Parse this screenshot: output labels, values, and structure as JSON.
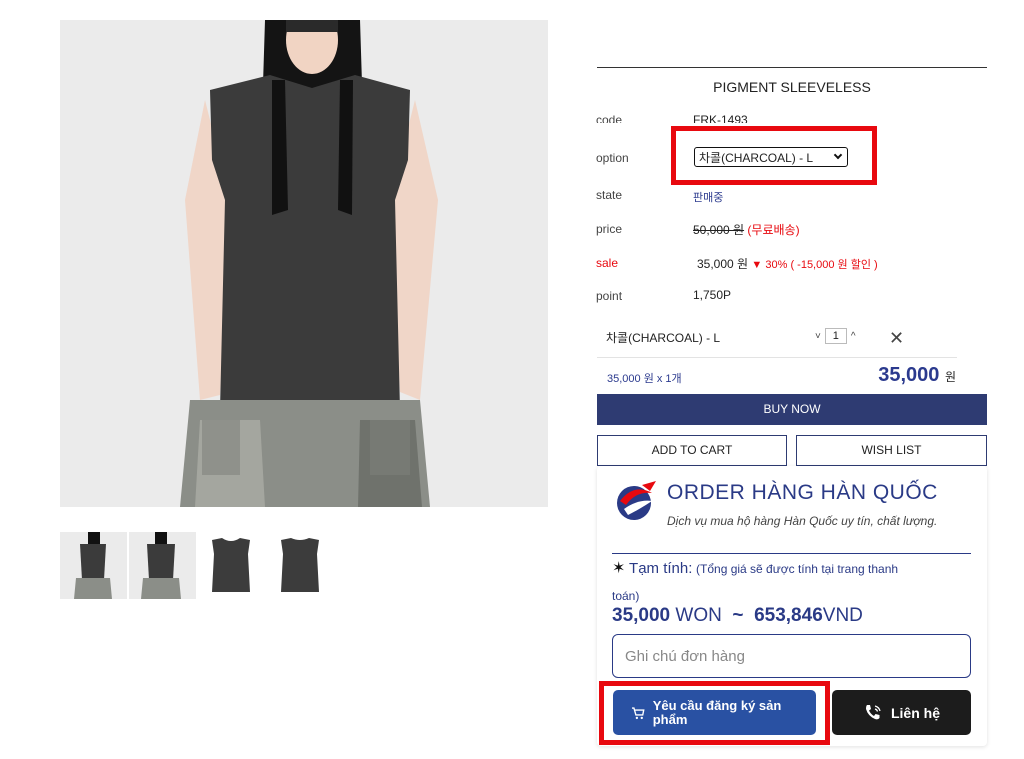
{
  "product": {
    "title": "PIGMENT SLEEVELESS",
    "rows": {
      "code_label": "code",
      "code_value": "FRK-1493",
      "option_label": "option",
      "option_value": "차콜(CHARCOAL) - L",
      "state_label": "state",
      "state_value": "판매중",
      "price_label": "price",
      "price_value": "50,000 원",
      "price_note": "(무료배송)",
      "sale_label": "sale",
      "sale_value": "35,000 원",
      "sale_discount": "▼ 30% ( -15,000 원 할인 )",
      "point_label": "point",
      "point_value": "1,750P"
    },
    "selected": {
      "name": "차콜(CHARCOAL) - L",
      "qty": "1",
      "up": "^",
      "down": "˅",
      "remove": "✕"
    },
    "summary": {
      "left": "35,000 원 x 1개",
      "total": "35,000",
      "unit": "원"
    },
    "buttons": {
      "buy_now": "BUY NOW",
      "add_to_cart": "ADD TO CART",
      "wish_list": "WISH LIST"
    }
  },
  "widget": {
    "title": "ORDER HÀNG HÀN QUỐC",
    "subtitle": "Dịch vụ mua hộ hàng Hàn Quốc uy tín, chất lượng.",
    "tam_tinh": "Tạm tính:",
    "tam_tinh_note": "(Tổng giá sẽ được tính tại trang thanh",
    "tam_tinh_note2": "toán)",
    "price_won": "35,000",
    "won_label": "WON",
    "tilde": "~",
    "price_vnd": "653,846",
    "vnd_label": "VND",
    "note_placeholder": "Ghi chú đơn hàng",
    "request_label": "Yêu cầu đăng ký sản phẩm",
    "contact_label": "Liên hệ"
  },
  "colors": {
    "navy": "#2e3b72",
    "blue": "#2951a3",
    "highlight": "#e8090f"
  }
}
